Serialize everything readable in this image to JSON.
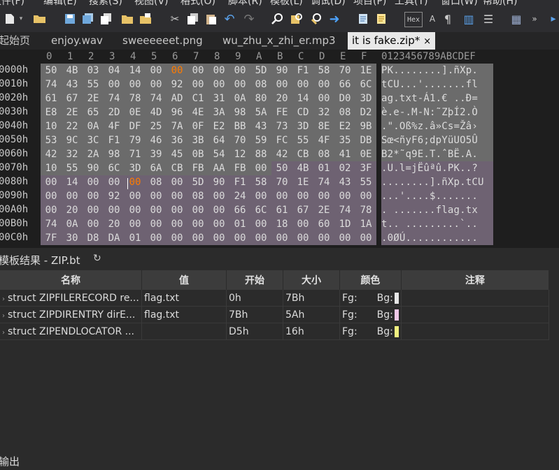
{
  "menu": [
    "文件(F)",
    "编辑(E)",
    "搜索(S)",
    "视图(V)",
    "格式(O)",
    "脚本(R)",
    "模板(L)",
    "调试(D)",
    "项目(P)",
    "工具(T)",
    "窗口(W)",
    "帮助(H)"
  ],
  "toolbar": {
    "hex_label": "Hex",
    "icons": [
      "new-file-icon",
      "open-folder-icon",
      "save-icon",
      "save-all-icon",
      "folder-icon",
      "open-icon",
      "cut-icon",
      "copy-icon",
      "paste-icon",
      "undo-icon",
      "redo-icon",
      "find-icon",
      "find-replace-icon",
      "goto-icon",
      "run-script-icon",
      "run-template-icon",
      "hex-mode-icon",
      "text-mode-icon",
      "pilcrow-icon",
      "columns-icon",
      "list-icon",
      "calculator-icon",
      "expand-icon"
    ]
  },
  "tabs": [
    {
      "label": "起始页",
      "active": false
    },
    {
      "label": "enjoy.wav",
      "active": false
    },
    {
      "label": "sweeeeeet.png",
      "active": false
    },
    {
      "label": "wu_zhu_x_zhi_er.mp3",
      "active": false
    },
    {
      "label": "it is fake.zip*",
      "active": true,
      "close": "×"
    }
  ],
  "hex": {
    "col_headers": [
      "0",
      "1",
      "2",
      "3",
      "4",
      "5",
      "6",
      "7",
      "8",
      "9",
      "A",
      "B",
      "C",
      "D",
      "E",
      "F"
    ],
    "ascii_header": "0123456789ABCDEF",
    "rows": [
      {
        "offset": "0000h",
        "bytes": [
          "50",
          "4B",
          "03",
          "04",
          "14",
          "00",
          "00",
          "00",
          "00",
          "00",
          "5D",
          "90",
          "F1",
          "58",
          "70",
          "1E"
        ],
        "ascii": "PK........].ñXp."
      },
      {
        "offset": "0010h",
        "bytes": [
          "74",
          "43",
          "55",
          "00",
          "00",
          "00",
          "92",
          "00",
          "00",
          "00",
          "08",
          "00",
          "00",
          "00",
          "66",
          "6C"
        ],
        "ascii": "tCU...'.......fl"
      },
      {
        "offset": "0020h",
        "bytes": [
          "61",
          "67",
          "2E",
          "74",
          "78",
          "74",
          "AD",
          "C1",
          "31",
          "0A",
          "80",
          "20",
          "14",
          "00",
          "D0",
          "3D"
        ],
        "ascii": "ag.txt-Á1.€ ..Ð="
      },
      {
        "offset": "0030h",
        "bytes": [
          "E8",
          "2E",
          "65",
          "2D",
          "0E",
          "4D",
          "96",
          "4E",
          "3A",
          "98",
          "5A",
          "FE",
          "CD",
          "32",
          "08",
          "D2"
        ],
        "ascii": "è.e-.M-N:˜ZþÍ2.Ò"
      },
      {
        "offset": "0040h",
        "bytes": [
          "10",
          "22",
          "0A",
          "4F",
          "DF",
          "25",
          "7A",
          "0F",
          "E2",
          "BB",
          "43",
          "73",
          "3D",
          "8E",
          "E2",
          "9B"
        ],
        "ascii": ".\".Oß%z.â»Cs=Žâ›"
      },
      {
        "offset": "0050h",
        "bytes": [
          "53",
          "9C",
          "3C",
          "F1",
          "79",
          "46",
          "36",
          "3B",
          "64",
          "70",
          "59",
          "FC",
          "55",
          "4F",
          "35",
          "DB"
        ],
        "ascii": "Sœ<ñyF6;dpYüUO5Û"
      },
      {
        "offset": "0060h",
        "bytes": [
          "42",
          "32",
          "2A",
          "98",
          "71",
          "39",
          "45",
          "0B",
          "54",
          "12",
          "88",
          "42",
          "CB",
          "08",
          "41",
          "0E"
        ],
        "ascii": "B2*˜q9E.T.ˆBË.A."
      },
      {
        "offset": "0070h",
        "bytes": [
          "10",
          "55",
          "90",
          "6C",
          "3D",
          "6A",
          "CB",
          "FB",
          "AA",
          "FB",
          "00",
          "50",
          "4B",
          "01",
          "02",
          "3F"
        ],
        "ascii": ".U.l=jËûªû.PK..?"
      },
      {
        "offset": "0080h",
        "bytes": [
          "00",
          "14",
          "00",
          "00",
          "00",
          "08",
          "00",
          "5D",
          "90",
          "F1",
          "58",
          "70",
          "1E",
          "74",
          "43",
          "55"
        ],
        "ascii": "........].ñXp.tCU"
      },
      {
        "offset": "0090h",
        "bytes": [
          "00",
          "00",
          "00",
          "92",
          "00",
          "00",
          "00",
          "08",
          "00",
          "24",
          "00",
          "00",
          "00",
          "00",
          "00",
          "00"
        ],
        "ascii": "...'....$......."
      },
      {
        "offset": "00A0h",
        "bytes": [
          "00",
          "20",
          "00",
          "00",
          "00",
          "00",
          "00",
          "00",
          "00",
          "66",
          "6C",
          "61",
          "67",
          "2E",
          "74",
          "78"
        ],
        "ascii": ". .......flag.tx"
      },
      {
        "offset": "00B0h",
        "bytes": [
          "74",
          "0A",
          "00",
          "20",
          "00",
          "00",
          "00",
          "00",
          "00",
          "01",
          "00",
          "18",
          "00",
          "60",
          "1D",
          "1A"
        ],
        "ascii": "t.. .........`.."
      },
      {
        "offset": "00C0h",
        "bytes": [
          "7F",
          "30",
          "D8",
          "DA",
          "01",
          "00",
          "00",
          "00",
          "00",
          "00",
          "00",
          "00",
          "00",
          "00",
          "00",
          "00"
        ],
        "ascii": ".0ØÚ............"
      }
    ]
  },
  "template": {
    "title": "模板结果 - ZIP.bt",
    "refresh_icon": "refresh-icon",
    "columns": [
      "名称",
      "值",
      "开始",
      "大小",
      "颜色",
      "注释"
    ],
    "rows": [
      {
        "name": "struct ZIPFILERECORD re...",
        "value": "flag.txt",
        "start": "0h",
        "size": "7Bh",
        "fg": "Fg:",
        "bg": "Bg:",
        "bg_color": "#e6e6e6",
        "comment": ""
      },
      {
        "name": "struct ZIPDIRENTRY dirE...",
        "value": "flag.txt",
        "start": "7Bh",
        "size": "5Ah",
        "fg": "Fg:",
        "bg": "Bg:",
        "bg_color": "#f0c8e8",
        "comment": ""
      },
      {
        "name": "struct ZIPENDLOCATOR ...",
        "value": "",
        "start": "D5h",
        "size": "16h",
        "fg": "Fg:",
        "bg": "Bg:",
        "bg_color": "#f0f080",
        "comment": ""
      }
    ]
  },
  "output": {
    "label": "输出"
  },
  "colors": {
    "record_bg": "#6b6b6b",
    "direntry_bg": "#6e6272",
    "highlight_byte": "#ff7b00"
  }
}
